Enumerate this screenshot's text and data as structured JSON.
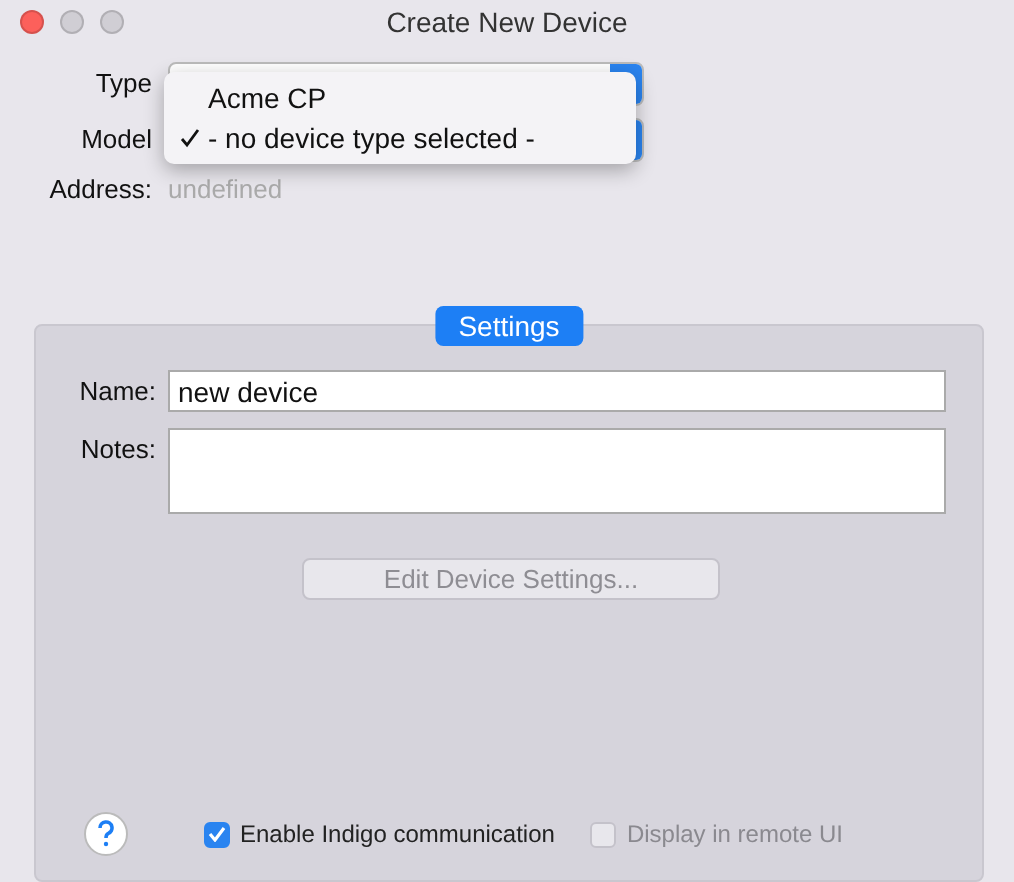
{
  "window": {
    "title": "Create New Device"
  },
  "form": {
    "type_label": "Type",
    "model_label": "Model",
    "address_label": "Address:",
    "address_value": "undefined"
  },
  "popup_menu": {
    "items": [
      {
        "label": "Acme CP",
        "selected": false
      },
      {
        "label": "- no device type selected -",
        "selected": true
      }
    ]
  },
  "settings": {
    "tab": "Settings",
    "name_label": "Name:",
    "name_value": "new device",
    "notes_label": "Notes:",
    "edit_button": {
      "label": "Edit Device Settings...",
      "disabled": true
    }
  },
  "footer": {
    "checkboxes": [
      {
        "label": "Enable Indigo communication",
        "checked": true,
        "disabled": false
      },
      {
        "label": "Display in remote UI",
        "checked": false,
        "disabled": true
      }
    ]
  }
}
